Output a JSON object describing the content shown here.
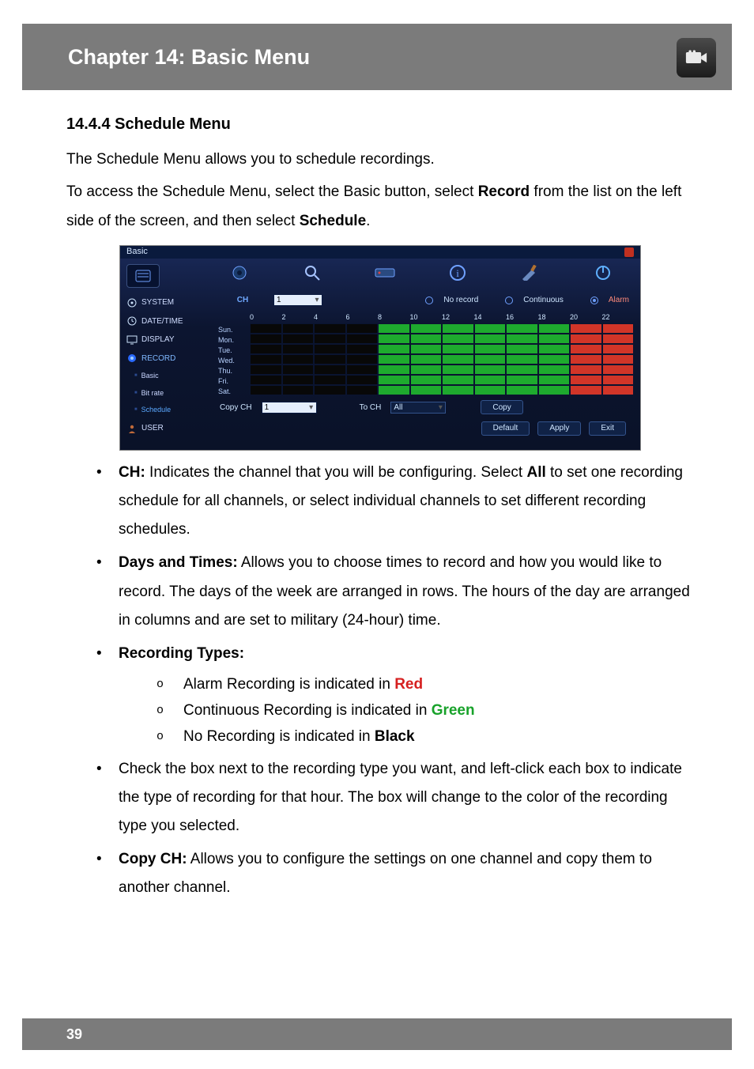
{
  "header": {
    "title": "Chapter 14: Basic Menu",
    "icon_name": "camera-icon"
  },
  "section": {
    "heading": "14.4.4 Schedule Menu",
    "intro1": "The Schedule Menu allows you to schedule recordings.",
    "intro2a": "To access the Schedule Menu, select the Basic button, select ",
    "intro2_strong1": "Record",
    "intro2b": " from the list on the left side of the screen, and then select ",
    "intro2_strong2": "Schedule",
    "intro2c": "."
  },
  "figure": {
    "window_title": "Basic",
    "sidebar_items": [
      {
        "label": "SYSTEM",
        "icon": "gear-icon"
      },
      {
        "label": "DATE/TIME",
        "icon": "clock-icon"
      },
      {
        "label": "DISPLAY",
        "icon": "monitor-icon"
      },
      {
        "label": "RECORD",
        "icon": "record-icon",
        "selected": true
      }
    ],
    "sidebar_subs": [
      {
        "label": "Basic"
      },
      {
        "label": "Bit rate"
      },
      {
        "label": "Schedule",
        "selected": true
      }
    ],
    "sidebar_last": {
      "label": "USER",
      "icon": "user-icon"
    },
    "legend": {
      "ch_label": "CH",
      "ch_value": "1",
      "no_record": "No record",
      "continuous": "Continuous",
      "alarm": "Alarm",
      "alarm_selected": true
    },
    "hours": [
      "0",
      "2",
      "4",
      "6",
      "8",
      "10",
      "12",
      "14",
      "16",
      "18",
      "20",
      "22"
    ],
    "days": [
      "Sun.",
      "Mon.",
      "Tue.",
      "Wed.",
      "Thu.",
      "Fri.",
      "Sat."
    ],
    "schedule_grid_note": "b=black(no record) g=green(continuous) r=red(alarm); 12 two-hour blocks per row",
    "rows": [
      [
        "b",
        "b",
        "b",
        "b",
        "g",
        "g",
        "g",
        "g",
        "g",
        "g",
        "r",
        "r"
      ],
      [
        "b",
        "b",
        "b",
        "b",
        "g",
        "g",
        "g",
        "g",
        "g",
        "g",
        "r",
        "r"
      ],
      [
        "b",
        "b",
        "b",
        "b",
        "g",
        "g",
        "g",
        "g",
        "g",
        "g",
        "r",
        "r"
      ],
      [
        "b",
        "b",
        "b",
        "b",
        "g",
        "g",
        "g",
        "g",
        "g",
        "g",
        "r",
        "r"
      ],
      [
        "b",
        "b",
        "b",
        "b",
        "g",
        "g",
        "g",
        "g",
        "g",
        "g",
        "r",
        "r"
      ],
      [
        "b",
        "b",
        "b",
        "b",
        "g",
        "g",
        "g",
        "g",
        "g",
        "g",
        "r",
        "r"
      ],
      [
        "b",
        "b",
        "b",
        "b",
        "g",
        "g",
        "g",
        "g",
        "g",
        "g",
        "r",
        "r"
      ]
    ],
    "copy": {
      "label": "Copy CH",
      "from_value": "1",
      "to_label": "To CH",
      "to_value": "All",
      "btn": "Copy"
    },
    "buttons": {
      "default": "Default",
      "apply": "Apply",
      "exit": "Exit"
    }
  },
  "bullets": {
    "b1_strong": "CH:",
    "b1a": " Indicates the channel that you will be configuring. Select ",
    "b1_all": "All",
    "b1b": " to set one recording schedule for all channels, or select individual channels to set different recording schedules.",
    "b2_strong": "Days and Times:",
    "b2": " Allows you to choose times to record and how you would like to record. The days of the week are arranged in rows. The hours of the day are arranged in columns and are set to military (24-hour) time.",
    "b3_strong": "Recording Types:",
    "b3_sub1a": "Alarm Recording is indicated in ",
    "b3_sub1_color": "Red",
    "b3_sub2a": "Continuous Recording is indicated in ",
    "b3_sub2_color": "Green",
    "b3_sub3a": "No Recording is indicated in ",
    "b3_sub3_b": "Black",
    "b4": "Check the box next to the recording type you want, and left-click each box to indicate the type of recording for that hour. The box will change to the color of the recording type you selected.",
    "b5_strong": "Copy CH:",
    "b5": " Allows you to configure the settings on one channel and copy them to another channel."
  },
  "page_number": "39"
}
